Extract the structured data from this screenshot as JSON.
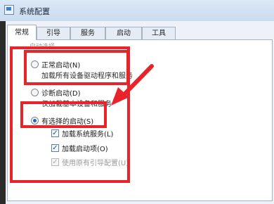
{
  "window": {
    "title": "系统配置"
  },
  "tabs": [
    "常规",
    "引导",
    "服务",
    "启动",
    "工具"
  ],
  "group": {
    "label": "启动选择"
  },
  "options": {
    "normal": {
      "label": "正常启动(N)",
      "desc": "加载所有设备驱动程序和服务",
      "selected": false
    },
    "diagnostic": {
      "label": "诊断启动(D)",
      "desc": "仅加载基本设备和服务",
      "selected": false
    },
    "selective": {
      "label": "有选择的启动(S)",
      "selected": true
    }
  },
  "selective_items": [
    {
      "label": "加载系统服务(L)",
      "checked": true,
      "enabled": true
    },
    {
      "label": "加载启动项(O)",
      "checked": true,
      "enabled": true
    },
    {
      "label": "使用原有引导配置(U)",
      "checked": true,
      "enabled": false
    }
  ],
  "colors": {
    "highlight": "#e8232a",
    "radio_selected": "#2466b8"
  }
}
